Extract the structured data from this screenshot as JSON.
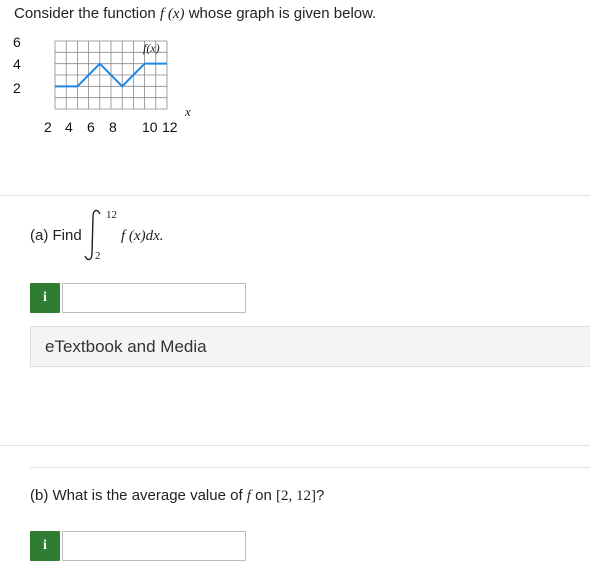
{
  "intro": {
    "prefix": "Consider the function",
    "func": "f (x)",
    "suffix": "whose graph is given below."
  },
  "graph": {
    "y_ticks": [
      "6",
      "4",
      "2"
    ],
    "x_ticks": [
      "2",
      "4",
      "6",
      "8",
      "10",
      "12"
    ],
    "curve_label": "f(x)",
    "x_var": "x",
    "line_color": "#1e88e5",
    "grid_color": "#888888",
    "points": [
      [
        2,
        2
      ],
      [
        4,
        2
      ],
      [
        6,
        4
      ],
      [
        8,
        2
      ],
      [
        10,
        4
      ],
      [
        12,
        4
      ]
    ]
  },
  "part_a": {
    "label": "(a) Find",
    "upper": "12",
    "lower": "2",
    "integrand": "f (x)dx."
  },
  "info_icon": "i",
  "etextbook": {
    "label": "eTextbook and Media"
  },
  "part_b": {
    "prefix": "(b) What is the average value of",
    "f": "f",
    "on": "on",
    "interval": "[2, 12]",
    "suffix": "?"
  },
  "colors": {
    "info_button": "#2e7d32",
    "graph_line": "#1e88e5"
  }
}
